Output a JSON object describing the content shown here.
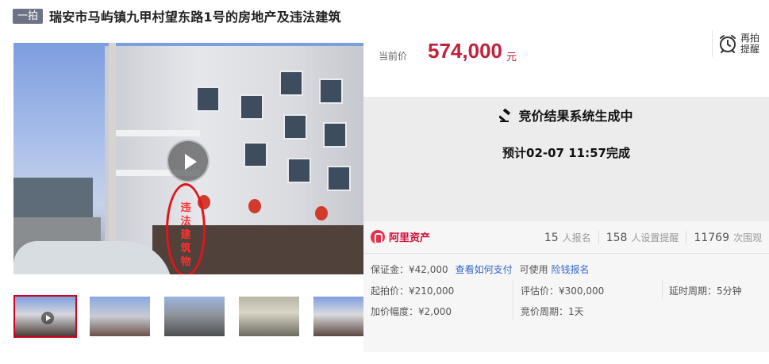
{
  "listing": {
    "badge": "一拍",
    "title": "瑞安市马屿镇九甲村望东路1号的房地产及违法建筑"
  },
  "gallery": {
    "main_overlay_text": [
      "违",
      "法",
      "建",
      "筑",
      "物"
    ]
  },
  "price": {
    "label": "当前价",
    "value": "574,000",
    "unit": "元"
  },
  "remind": {
    "label": "再拍提醒"
  },
  "status": {
    "line1": "竞价结果系统生成中",
    "line2": "预计02-07 11:57完成"
  },
  "brand": {
    "name": "阿里资产"
  },
  "stats": [
    {
      "num": "15",
      "label": "人报名"
    },
    {
      "num": "158",
      "label": "人设置提醒"
    },
    {
      "num": "11769",
      "label": "次围观"
    }
  ],
  "deposit": {
    "text": "保证金：¥42,000",
    "how_to_pay": "查看如何支付",
    "usable": "可使用",
    "insurance_link": "险钱报名"
  },
  "terms": {
    "start_price": "起拍价：¥210,000",
    "appraisal": "评估价：¥300,000",
    "delay_period": "延时周期：5分钟",
    "increment": "加价幅度：¥2,000",
    "bid_period": "竞价周期：1天"
  },
  "colors": {
    "price_red": "#c2203b",
    "brand_red": "#d0103a",
    "link_blue": "#3366cc",
    "badge_gray": "#6d7385"
  }
}
